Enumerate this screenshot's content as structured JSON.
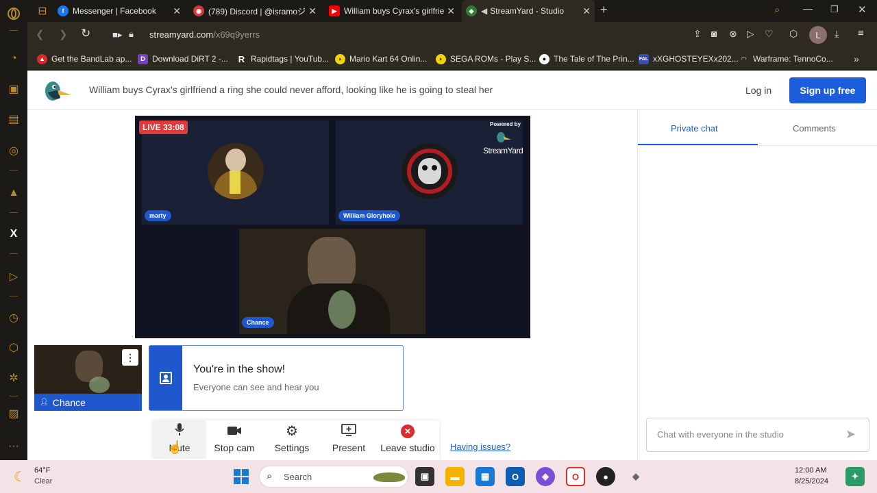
{
  "browser": {
    "tabs": [
      {
        "label": "Messenger | Facebook",
        "icon": "facebook-icon",
        "color": "#1877f2"
      },
      {
        "label": "(789) Discord | @isramoジ",
        "icon": "discord-icon",
        "color": "#d33b3b"
      },
      {
        "label": "William buys Cyrax's girlfrie",
        "icon": "youtube-icon",
        "color": "#ff0000"
      },
      {
        "label": "StreamYard - Studio",
        "icon": "streamyard-icon",
        "color": "#2e7d32"
      }
    ],
    "url_host": "streamyard.com",
    "url_path": "/x69q9yerrs",
    "profile_initial": "L",
    "bookmarks": [
      {
        "label": "Get the BandLab ap...",
        "color": "#d92b2b"
      },
      {
        "label": "Download DiRT 2 -...",
        "color": "#7b3fc4"
      },
      {
        "label": "Rapidtags | YouTub...",
        "color": "#2e2a22"
      },
      {
        "label": "Mario Kart 64 Onlin...",
        "color": "#f4d400"
      },
      {
        "label": "SEGA ROMs - Play S...",
        "color": "#f4d400"
      },
      {
        "label": "The Tale of The Prin...",
        "color": "#ffffff"
      },
      {
        "label": "xXGHOSTEYEXx202...",
        "color": "#3a4fb0"
      },
      {
        "label": "Warframe: TennoCo...",
        "color": "#999999"
      }
    ]
  },
  "header": {
    "broadcast_title": "William buys Cyrax's girlfriend a ring she could never afford, looking like he is going to steal her",
    "login": "Log in",
    "signup": "Sign up free"
  },
  "stage": {
    "live": "LIVE 33:08",
    "powered_by": "Powered by",
    "brand": "StreamYard",
    "participants": [
      "marty",
      "William Gloryhole",
      "Chance"
    ]
  },
  "self": {
    "name": "Chance",
    "show_title": "You're in the show!",
    "show_sub": "Everyone can see and hear you"
  },
  "controls": {
    "mute": "Mute",
    "stop_cam": "Stop cam",
    "settings": "Settings",
    "present": "Present",
    "leave": "Leave studio",
    "having_issues": "Having issues?"
  },
  "chat": {
    "tab_private": "Private chat",
    "tab_comments": "Comments",
    "placeholder": "Chat with everyone in the studio"
  },
  "taskbar": {
    "temp": "64°F",
    "weather": "Clear",
    "search": "Search",
    "time": "12:00 AM",
    "date": "8/25/2024"
  }
}
